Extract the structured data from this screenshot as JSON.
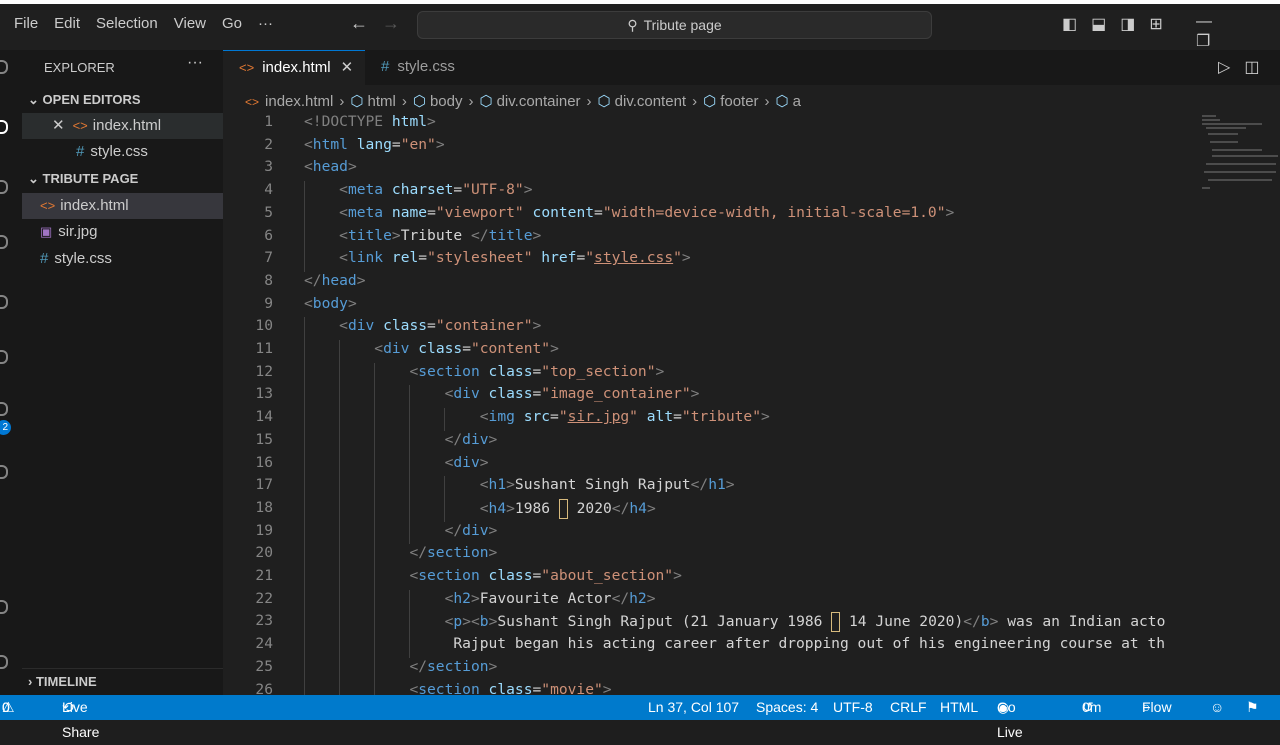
{
  "menu": [
    "File",
    "Edit",
    "Selection",
    "View",
    "Go",
    "···"
  ],
  "search": {
    "label": "Tribute page"
  },
  "explorer": {
    "title": "EXPLORER",
    "more": "···",
    "open_editors": {
      "header": "OPEN EDITORS",
      "items": [
        {
          "name": "index.html",
          "type": "html"
        },
        {
          "name": "style.css",
          "type": "css"
        }
      ]
    },
    "project": {
      "header": "TRIBUTE PAGE",
      "items": [
        {
          "name": "index.html",
          "type": "html"
        },
        {
          "name": "sir.jpg",
          "type": "image"
        },
        {
          "name": "style.css",
          "type": "css"
        }
      ]
    },
    "timeline": "TIMELINE"
  },
  "activity_badge": "2",
  "tabs": [
    {
      "label": "index.html",
      "type": "html",
      "active": true
    },
    {
      "label": "style.css",
      "type": "css",
      "active": false
    }
  ],
  "breadcrumbs": [
    "index.html",
    "html",
    "body",
    "div.container",
    "div.content",
    "footer",
    "a"
  ],
  "code": {
    "line_numbers": [
      "1",
      "2",
      "3",
      "4",
      "5",
      "6",
      "7",
      "8",
      "9",
      "10",
      "11",
      "12",
      "13",
      "14",
      "15",
      "16",
      "17",
      "18",
      "19",
      "20",
      "21",
      "22",
      "23",
      "24",
      "25",
      "26"
    ],
    "indent_levels": [
      0,
      0,
      0,
      1,
      1,
      1,
      1,
      0,
      0,
      1,
      2,
      3,
      4,
      5,
      4,
      4,
      5,
      5,
      4,
      3,
      3,
      4,
      4,
      4,
      3,
      3
    ]
  },
  "status": {
    "errors": "0",
    "warnings": "0",
    "live_share": "Live Share",
    "position": "Ln 37, Col 107",
    "spaces": "Spaces: 4",
    "encoding": "UTF-8",
    "eol": "CRLF",
    "language": "HTML",
    "go_live": "Go Live",
    "time": "0m",
    "flow": "Flow"
  },
  "colors": {
    "status_bar": "#007acc",
    "tag": "#569cd6",
    "attribute": "#9cdcfe",
    "string": "#ce9178"
  }
}
